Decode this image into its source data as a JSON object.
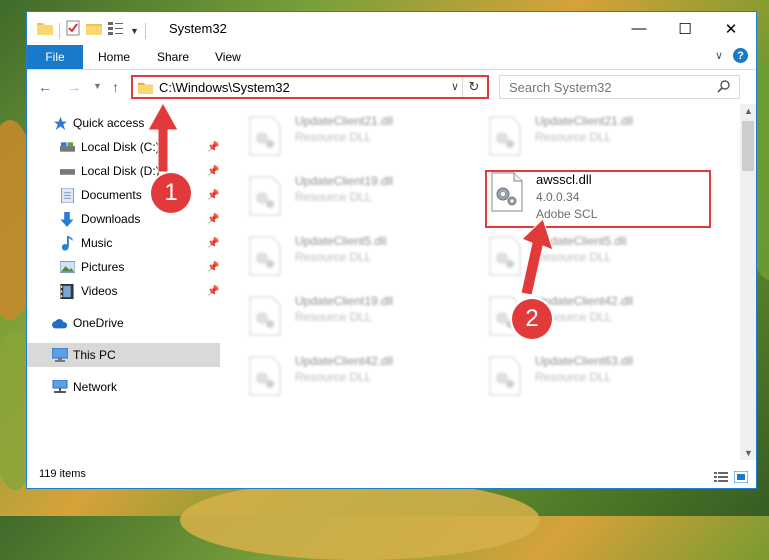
{
  "window": {
    "title": "System32",
    "controls": {
      "minimize": "—",
      "maximize": "☐",
      "close": "✕"
    }
  },
  "ribbon": {
    "tabs": [
      "File",
      "Home",
      "Share",
      "View"
    ],
    "collapse_glyph": "∨",
    "help_glyph": "?"
  },
  "address_bar": {
    "path": "C:\\Windows\\System32",
    "dropdown_glyph": "∨",
    "refresh_glyph": "↻"
  },
  "search": {
    "placeholder": "Search System32"
  },
  "sidebar": {
    "items": [
      {
        "label": "Quick access",
        "icon": "star-icon"
      },
      {
        "label": "Local Disk (C:)",
        "icon": "drive-icon",
        "pinned": true
      },
      {
        "label": "Local Disk (D:)",
        "icon": "drive-icon",
        "pinned": true
      },
      {
        "label": "Documents",
        "icon": "documents-icon",
        "pinned": true
      },
      {
        "label": "Downloads",
        "icon": "download-icon",
        "pinned": true
      },
      {
        "label": "Music",
        "icon": "music-icon",
        "pinned": true
      },
      {
        "label": "Pictures",
        "icon": "pictures-icon",
        "pinned": true
      },
      {
        "label": "Videos",
        "icon": "videos-icon",
        "pinned": true
      },
      {
        "label": "OneDrive",
        "icon": "cloud-icon"
      },
      {
        "label": "This PC",
        "icon": "computer-icon",
        "selected": true
      },
      {
        "label": "Network",
        "icon": "network-icon"
      }
    ],
    "pin_glyph": "📌"
  },
  "files": [
    {
      "name": "UpdateClient21.dll",
      "type": "Resource DLL"
    },
    {
      "name": "UpdateClient21.dll",
      "type": "Resource DLL"
    },
    {
      "name": "UpdateClient19.dll",
      "type": "Resource DLL"
    },
    {
      "name": "awsscl.dll",
      "version": "4.0.0.34",
      "type": "Adobe SCL",
      "highlighted": true
    },
    {
      "name": "UpdateClient5.dll",
      "type": "Resource DLL"
    },
    {
      "name": "UpdateClient5.dll",
      "type": "Resource DLL"
    },
    {
      "name": "UpdateClient19.dll",
      "type": "Resource DLL"
    },
    {
      "name": "UpdateClient42.dll",
      "type": "Resource DLL"
    },
    {
      "name": "UpdateClient42.dll",
      "type": "Resource DLL"
    },
    {
      "name": "UpdateClient63.dll",
      "type": "Resource DLL"
    }
  ],
  "status": {
    "item_count": "119 items"
  },
  "annotations": {
    "step1": "1",
    "step2": "2"
  },
  "colors": {
    "accent": "#1979ca",
    "annotation": "#e23a3a",
    "selection": "#d9d9d9"
  }
}
